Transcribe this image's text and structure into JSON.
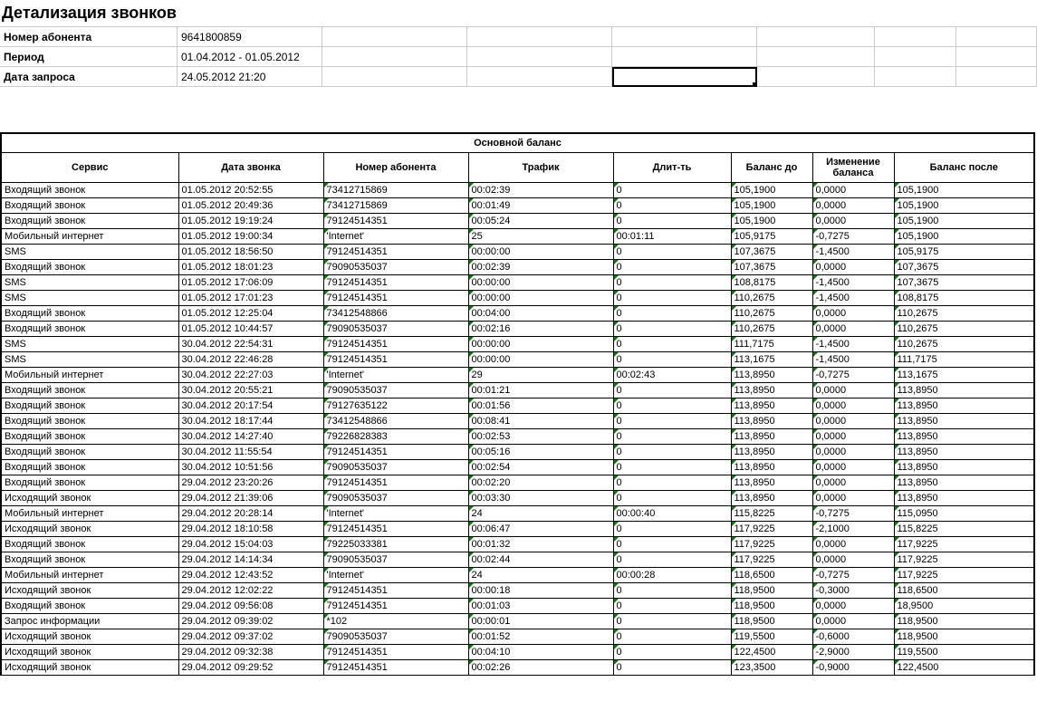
{
  "title": "Детализация звонков",
  "header": {
    "subscriber_label": "Номер абонента",
    "subscriber_value": "9641800859",
    "period_label": "Период",
    "period_value": "01.04.2012 - 01.05.2012",
    "request_date_label": "Дата запроса",
    "request_date_value": "24.05.2012 21:20"
  },
  "table_section": "Основной баланс",
  "columns": {
    "service": "Сервис",
    "call_date": "Дата звонка",
    "number": "Номер абонента",
    "traffic": "Трафик",
    "duration": "Длит-ть",
    "balance_before": "Баланс до",
    "balance_change": "Изменение баланса",
    "balance_after": "Баланс после"
  },
  "rows": [
    {
      "service": "Входящий звонок",
      "date": "01.05.2012 20:52:55",
      "number": "73412715869",
      "traffic": "00:02:39",
      "duration": "0",
      "before": "105,1900",
      "change": "0,0000",
      "after": "105,1900"
    },
    {
      "service": "Входящий звонок",
      "date": "01.05.2012 20:49:36",
      "number": "73412715869",
      "traffic": "00:01:49",
      "duration": "0",
      "before": "105,1900",
      "change": "0,0000",
      "after": "105,1900"
    },
    {
      "service": "Входящий звонок",
      "date": "01.05.2012 19:19:24",
      "number": "79124514351",
      "traffic": "00:05:24",
      "duration": "0",
      "before": "105,1900",
      "change": "0,0000",
      "after": "105,1900"
    },
    {
      "service": "Мобильный интернет",
      "date": "01.05.2012 19:00:34",
      "number": "'Internet'",
      "traffic": "25",
      "duration": "00:01:11",
      "before": "105,9175",
      "change": "-0,7275",
      "after": "105,1900"
    },
    {
      "service": "SMS",
      "date": "01.05.2012 18:56:50",
      "number": "79124514351",
      "traffic": "00:00:00",
      "duration": "0",
      "before": "107,3675",
      "change": "-1,4500",
      "after": "105,9175"
    },
    {
      "service": "Входящий звонок",
      "date": "01.05.2012 18:01:23",
      "number": "79090535037",
      "traffic": "00:02:39",
      "duration": "0",
      "before": "107,3675",
      "change": "0,0000",
      "after": "107,3675"
    },
    {
      "service": "SMS",
      "date": "01.05.2012 17:06:09",
      "number": "79124514351",
      "traffic": "00:00:00",
      "duration": "0",
      "before": "108,8175",
      "change": "-1,4500",
      "after": "107,3675"
    },
    {
      "service": "SMS",
      "date": "01.05.2012 17:01:23",
      "number": "79124514351",
      "traffic": "00:00:00",
      "duration": "0",
      "before": "110,2675",
      "change": "-1,4500",
      "after": "108,8175"
    },
    {
      "service": "Входящий звонок",
      "date": "01.05.2012 12:25:04",
      "number": "73412548866",
      "traffic": "00:04:00",
      "duration": "0",
      "before": "110,2675",
      "change": "0,0000",
      "after": "110,2675"
    },
    {
      "service": "Входящий звонок",
      "date": "01.05.2012 10:44:57",
      "number": "79090535037",
      "traffic": "00:02:16",
      "duration": "0",
      "before": "110,2675",
      "change": "0,0000",
      "after": "110,2675"
    },
    {
      "service": "SMS",
      "date": "30.04.2012 22:54:31",
      "number": "79124514351",
      "traffic": "00:00:00",
      "duration": "0",
      "before": "111,7175",
      "change": "-1,4500",
      "after": "110,2675"
    },
    {
      "service": "SMS",
      "date": "30.04.2012 22:46:28",
      "number": "79124514351",
      "traffic": "00:00:00",
      "duration": "0",
      "before": "113,1675",
      "change": "-1,4500",
      "after": "111,7175"
    },
    {
      "service": "Мобильный интернет",
      "date": "30.04.2012 22:27:03",
      "number": "'Internet'",
      "traffic": "29",
      "duration": "00:02:43",
      "before": "113,8950",
      "change": "-0,7275",
      "after": "113,1675"
    },
    {
      "service": "Входящий звонок",
      "date": "30.04.2012 20:55:21",
      "number": "79090535037",
      "traffic": "00:01:21",
      "duration": "0",
      "before": "113,8950",
      "change": "0,0000",
      "after": "113,8950"
    },
    {
      "service": "Входящий звонок",
      "date": "30.04.2012 20:17:54",
      "number": "79127635122",
      "traffic": "00:01:56",
      "duration": "0",
      "before": "113,8950",
      "change": "0,0000",
      "after": "113,8950"
    },
    {
      "service": "Входящий звонок",
      "date": "30.04.2012 18:17:44",
      "number": "73412548866",
      "traffic": "00:08:41",
      "duration": "0",
      "before": "113,8950",
      "change": "0,0000",
      "after": "113,8950"
    },
    {
      "service": "Входящий звонок",
      "date": "30.04.2012 14:27:40",
      "number": "79226828383",
      "traffic": "00:02:53",
      "duration": "0",
      "before": "113,8950",
      "change": "0,0000",
      "after": "113,8950"
    },
    {
      "service": "Входящий звонок",
      "date": "30.04.2012 11:55:54",
      "number": "79124514351",
      "traffic": "00:05:16",
      "duration": "0",
      "before": "113,8950",
      "change": "0,0000",
      "after": "113,8950"
    },
    {
      "service": "Входящий звонок",
      "date": "30.04.2012 10:51:56",
      "number": "79090535037",
      "traffic": "00:02:54",
      "duration": "0",
      "before": "113,8950",
      "change": "0,0000",
      "after": "113,8950"
    },
    {
      "service": "Входящий звонок",
      "date": "29.04.2012 23:20:26",
      "number": "79124514351",
      "traffic": "00:02:20",
      "duration": "0",
      "before": "113,8950",
      "change": "0,0000",
      "after": "113,8950"
    },
    {
      "service": "Исходящий звонок",
      "date": "29.04.2012 21:39:06",
      "number": "79090535037",
      "traffic": "00:03:30",
      "duration": "0",
      "before": "113,8950",
      "change": "0,0000",
      "after": "113,8950"
    },
    {
      "service": "Мобильный интернет",
      "date": "29.04.2012 20:28:14",
      "number": "'Internet'",
      "traffic": "24",
      "duration": "00:00:40",
      "before": "115,8225",
      "change": "-0,7275",
      "after": "115,0950"
    },
    {
      "service": "Исходящий звонок",
      "date": "29.04.2012 18:10:58",
      "number": "79124514351",
      "traffic": "00:06:47",
      "duration": "0",
      "before": "117,9225",
      "change": "-2,1000",
      "after": "115,8225"
    },
    {
      "service": "Входящий звонок",
      "date": "29.04.2012 15:04:03",
      "number": "79225033381",
      "traffic": "00:01:32",
      "duration": "0",
      "before": "117,9225",
      "change": "0,0000",
      "after": "117,9225"
    },
    {
      "service": "Входящий звонок",
      "date": "29.04.2012 14:14:34",
      "number": "79090535037",
      "traffic": "00:02:44",
      "duration": "0",
      "before": "117,9225",
      "change": "0,0000",
      "after": "117,9225"
    },
    {
      "service": "Мобильный интернет",
      "date": "29.04.2012 12:43:52",
      "number": "'Internet'",
      "traffic": "24",
      "duration": "00:00:28",
      "before": "118,6500",
      "change": "-0,7275",
      "after": "117,9225"
    },
    {
      "service": "Исходящий звонок",
      "date": "29.04.2012 12:02:22",
      "number": "79124514351",
      "traffic": "00:00:18",
      "duration": "0",
      "before": "118,9500",
      "change": "-0,3000",
      "after": "118,6500"
    },
    {
      "service": "Входящий звонок",
      "date": "29.04.2012 09:56:08",
      "number": "79124514351",
      "traffic": "00:01:03",
      "duration": "0",
      "before": "118,9500",
      "change": "0,0000",
      "after": "18,9500"
    },
    {
      "service": "Запрос информации",
      "date": "29.04.2012 09:39:02",
      "number": "*102",
      "traffic": "00:00:01",
      "duration": "0",
      "before": "118,9500",
      "change": "0,0000",
      "after": "118,9500"
    },
    {
      "service": "Исходящий звонок",
      "date": "29.04.2012 09:37:02",
      "number": "79090535037",
      "traffic": "00:01:52",
      "duration": "0",
      "before": "119,5500",
      "change": "-0,6000",
      "after": "118,9500"
    },
    {
      "service": "Исходящий звонок",
      "date": "29.04.2012 09:32:38",
      "number": "79124514351",
      "traffic": "00:04:10",
      "duration": "0",
      "before": "122,4500",
      "change": "-2,9000",
      "after": "119,5500"
    },
    {
      "service": "Исходящий звонок",
      "date": "29.04.2012 09:29:52",
      "number": "79124514351",
      "traffic": "00:02:26",
      "duration": "0",
      "before": "123,3500",
      "change": "-0,9000",
      "after": "122,4500"
    }
  ]
}
